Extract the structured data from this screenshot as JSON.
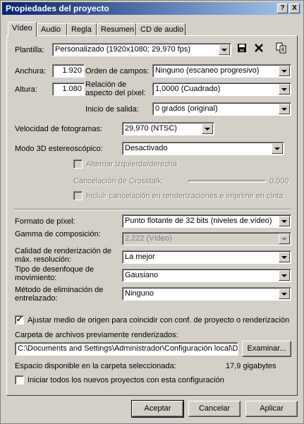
{
  "window": {
    "title": "Propiedades del proyecto",
    "help_glyph": "?",
    "close_glyph": "X"
  },
  "tabs": [
    {
      "label": "Vídeo",
      "active": true
    },
    {
      "label": "Audio"
    },
    {
      "label": "Regla"
    },
    {
      "label": "Resumen"
    },
    {
      "label": "CD de audio"
    }
  ],
  "template": {
    "label": "Plantilla:",
    "value": "Personalizado (1920x1080; 29,970 fps)",
    "save_icon": "floppy-disk-icon",
    "delete_icon": "delete-x-icon",
    "copy_icon": "copy-template-icon"
  },
  "width": {
    "label": "Anchura:",
    "value": "1.920"
  },
  "height": {
    "label": "Altura:",
    "value": "1.080"
  },
  "field_order": {
    "label": "Orden de campos:",
    "value": "Ninguno (escaneo progresivo)"
  },
  "pixel_aspect": {
    "label": "Relación de aspecto del píxel:",
    "value": "1,0000 (Cuadrado)"
  },
  "output_rotation": {
    "label": "Inicio de salida:",
    "value": "0 grados (original)"
  },
  "frame_rate": {
    "label": "Velocidad de fotogramas:",
    "value": "29,970 (NTSC)"
  },
  "stereo3d": {
    "label": "Modo 3D estereoscópico:",
    "value": "Desactivado"
  },
  "swap_lr": {
    "label": "Alternar izquierda/derecha",
    "checked": false,
    "enabled": false
  },
  "crosstalk": {
    "label": "Cancelación de Crosstalk:",
    "value": "0,000",
    "enabled": false
  },
  "include_crosstalk": {
    "label": "Incluir cancelación en renderizaciones e imprimir en cinta",
    "checked": false,
    "enabled": false
  },
  "pixel_format": {
    "label": "Formato de píxel:",
    "value": "Punto flotante de 32 bits (niveles de vídeo)"
  },
  "gamma": {
    "label": "Gamma de composición:",
    "value": "2,222 (Vídeo)",
    "enabled": false
  },
  "render_quality": {
    "label": "Calidad de renderización de máx. resolución:",
    "value": "La mejor"
  },
  "motion_blur": {
    "label": "Tipo de desenfoque de movimiento:",
    "value": "Gausiano"
  },
  "deinterlace": {
    "label": "Método de eliminación de entrelazado:",
    "value": "Ninguno"
  },
  "adjust_source": {
    "label": "Ajustar medio de origen para coincidir con conf. de proyecto o renderización",
    "checked": true
  },
  "prerender_folder": {
    "label": "Carpeta de archivos previamente renderizados:",
    "value": "C:\\Documents and Settings\\Administrador\\Configuración local\\Da",
    "browse_label": "Examinar..."
  },
  "free_space": {
    "label": "Espacio disponible en la carpeta seleccionada:",
    "value": "17,9 gigabytes"
  },
  "start_new": {
    "label": "Iniciar todos los nuevos proyectos con esta configuración",
    "checked": false
  },
  "buttons": {
    "ok": "Aceptar",
    "cancel": "Cancelar",
    "apply": "Aplicar"
  }
}
